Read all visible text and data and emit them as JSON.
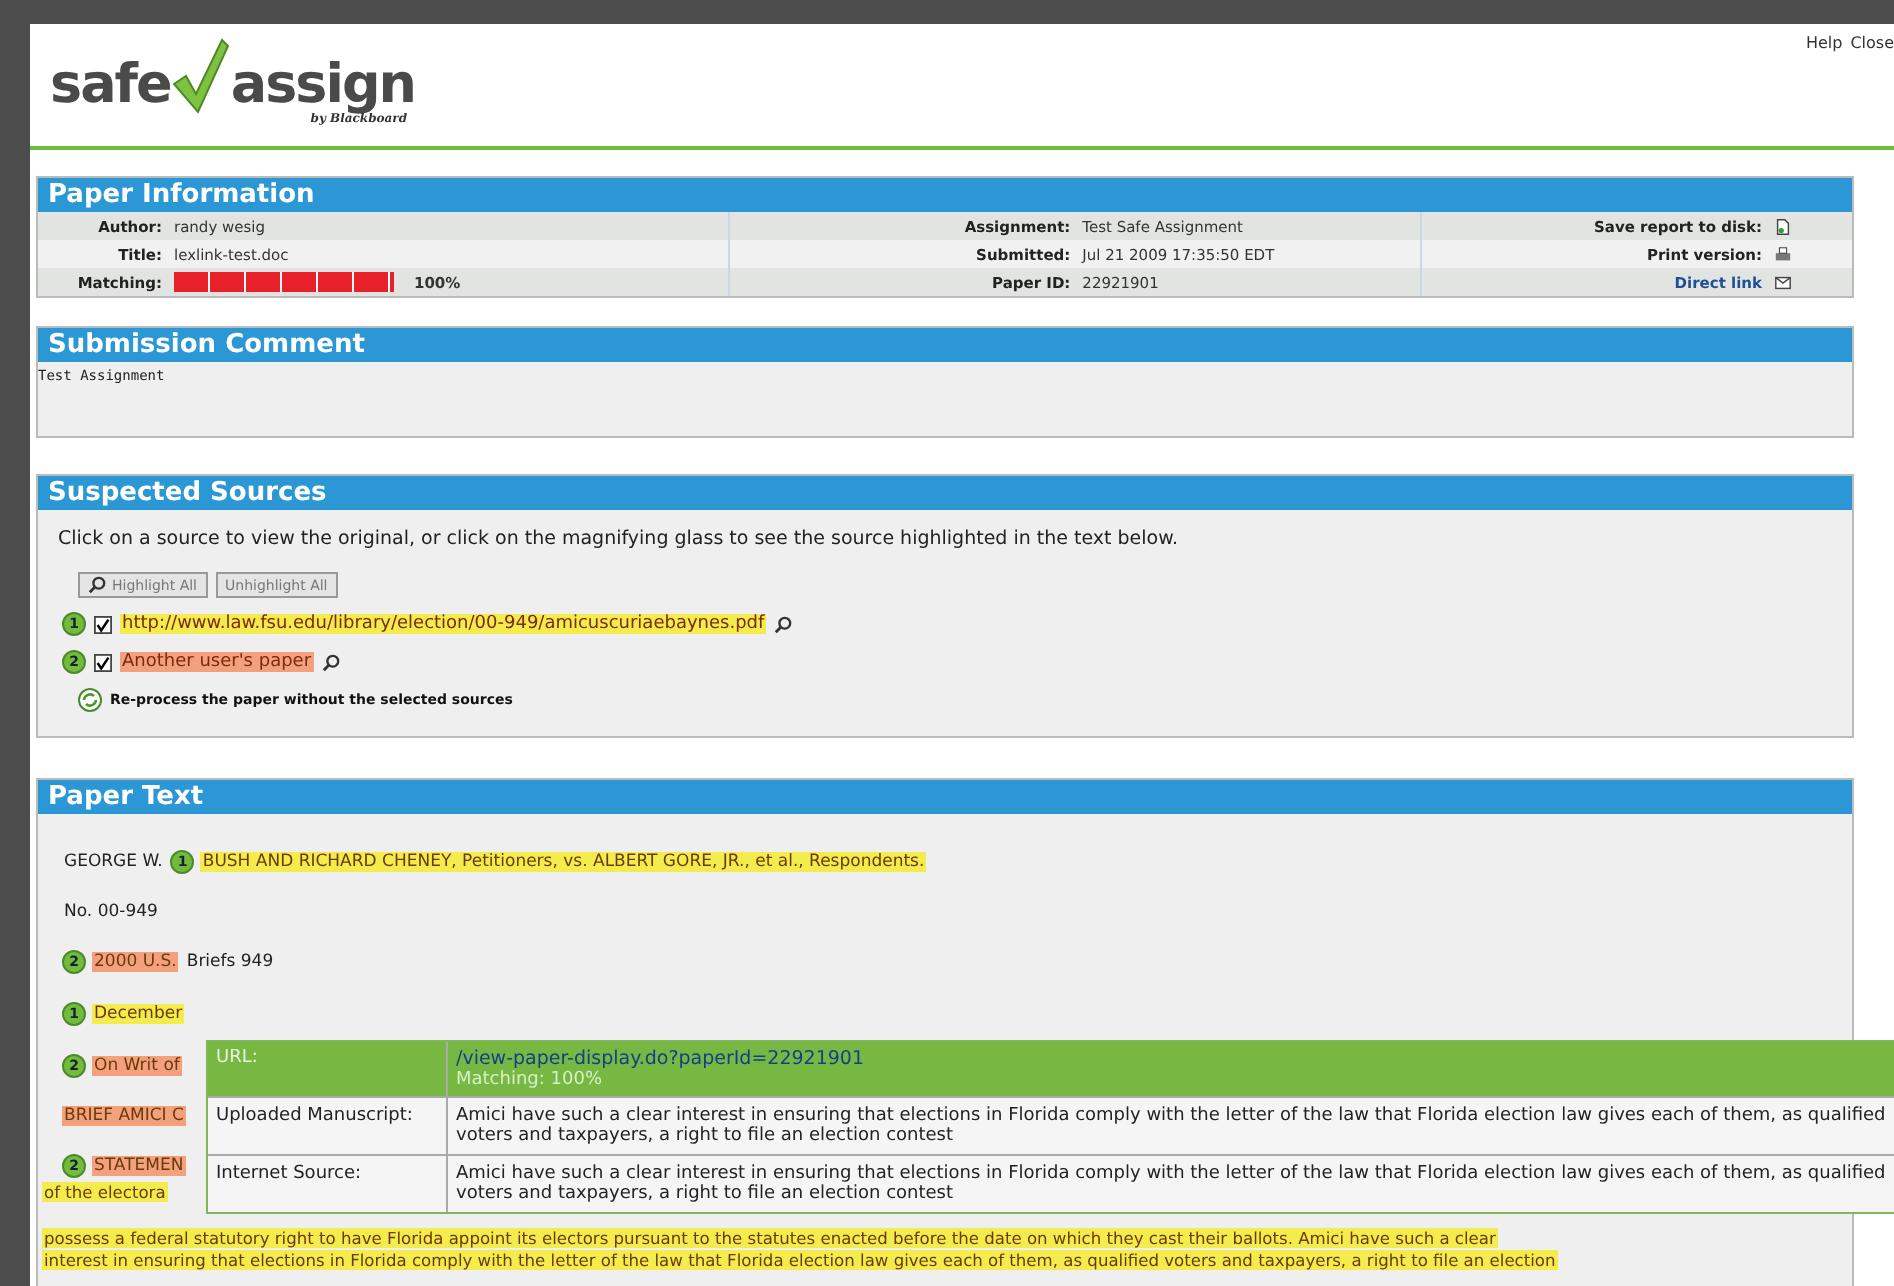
{
  "header": {
    "logo": {
      "word_left": "safe",
      "word_right": "assign",
      "byline": "by Blackboard"
    },
    "links": [
      "Help",
      "Close"
    ]
  },
  "paper_information": {
    "title": "Paper Information",
    "left": [
      {
        "label": "Author:",
        "value": "randy wesig"
      },
      {
        "label": "Title:",
        "value": "lexlink-test.doc"
      }
    ],
    "matching": {
      "label": "Matching:",
      "level": 1.0,
      "reading": "100%"
    },
    "middle": [
      {
        "label": "Assignment:",
        "value": "Test Safe Assignment"
      },
      {
        "label": "Submitted:",
        "value": "Jul 21 2009 17:35:50 EDT"
      },
      {
        "label": "Paper ID:",
        "value": "22921901"
      }
    ],
    "right": [
      {
        "label": "Save report to disk:",
        "kind": "save"
      },
      {
        "label": "Print version:",
        "kind": "print"
      },
      {
        "label": "Direct link",
        "kind": "link"
      }
    ]
  },
  "submission_comment": {
    "title": "Submission Comment",
    "text": "Test Assignment"
  },
  "suspected_sources": {
    "title": "Suspected Sources",
    "instructions": "Click on a source to view the original, or click on the magnifying glass to see the source highlighted in the text below.",
    "buttons": [
      "Highlight All",
      "Unhighlight All"
    ],
    "sources": [
      {
        "number": "1",
        "checked": true,
        "label": "http://www.law.fsu.edu/library/election/00-949/amicuscuriaebaynes.pdf",
        "color": "#f3ec4c"
      },
      {
        "number": "2",
        "checked": true,
        "label": "Another user's paper",
        "color": "#f3a07c"
      }
    ],
    "reprocess": "Re-process the paper without the selected sources"
  },
  "paper_text": {
    "title": "Paper Text",
    "lines": [
      [
        {
          "text": "GEORGE W. "
        },
        {
          "number": "1",
          "text": "BUSH AND RICHARD CHENEY, Petitioners, vs. ALBERT GORE, JR., et al., Respondents.",
          "color": "#f3ec4c"
        }
      ],
      [
        {
          "text": "No. 00-949"
        }
      ],
      [
        {
          "number": "2",
          "text": "2000 U.S. ",
          "color": "#f3a07c"
        },
        {
          "text": "Briefs 949"
        }
      ],
      [
        {
          "number": "1",
          "text": "December",
          "color": "#f3ec4c"
        }
      ],
      [
        {
          "number": "2",
          "text": "On Writ of",
          "color": "#f3a07c"
        }
      ],
      [
        {
          "text": "BRIEF AMICI C",
          "color": "#f3a07c"
        }
      ],
      [
        {
          "number": "2",
          "text": "STATEMEN",
          "color": "#f3a07c"
        }
      ]
    ],
    "paragraph": [
      {
        "text": "of the electora",
        "color": "#f3ec4c"
      },
      {
        "text": "possess a federal statutory right to have Florida appoint its electors pursuant to the statutes enacted before the date on which they cast their ballots. Amici have such a clear",
        "color": "#f3ec4c"
      },
      {
        "text": "interest in ensuring that elections in Florida comply with the letter of the law that Florida election law gives each of them, as qualified voters and taxpayers, a right to file an election",
        "color": "#f3ec4c"
      }
    ]
  },
  "popup": {
    "url_label": "URL:",
    "url": "/view-paper-display.do?paperId=22921901",
    "matching": "Matching: 100%",
    "rows": [
      {
        "label": "Uploaded Manuscript:",
        "text": "Amici have such a clear interest in ensuring that elections in Florida comply with the letter of the law that Florida election law gives each of them, as qualified voters and taxpayers, a right to file an election contest"
      },
      {
        "label": "Internet Source:",
        "text": "Amici have such a clear interest in ensuring that elections in Florida comply with the letter of the law that Florida election law gives each of them, as qualified voters and taxpayers, a right to file an election contest"
      }
    ]
  }
}
